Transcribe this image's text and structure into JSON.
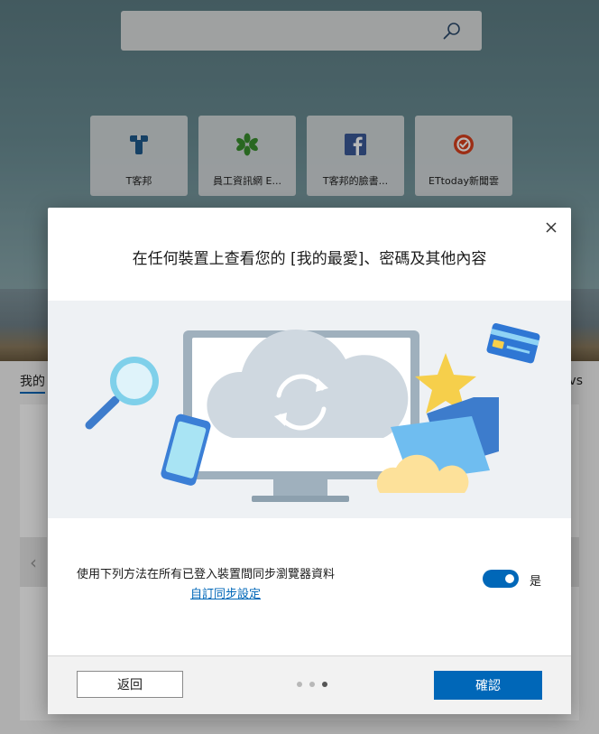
{
  "search": {
    "icon": "search-icon"
  },
  "quick_links": [
    {
      "label": "T客邦",
      "icon": "wrench-logo-icon",
      "color": "#1f5a8c"
    },
    {
      "label": "員工資訊網 E...",
      "icon": "green-asterisk-icon",
      "color": "#3a8f2e"
    },
    {
      "label": "T客邦的臉書...",
      "icon": "facebook-icon",
      "color": "#3b5998"
    },
    {
      "label": "ETtoday新聞雲",
      "icon": "ettoday-icon",
      "color": "#d9411e"
    }
  ],
  "feed": {
    "left_label": "我的",
    "right_label": "vs"
  },
  "dialog": {
    "title": "在任何裝置上查看您的 [我的最愛]、密碼及其他內容",
    "sync_text": "使用下列方法在所有已登入裝置間同步瀏覽器資料",
    "sync_link": "自訂同步設定",
    "toggle_label": "是",
    "toggle_on": true,
    "back_label": "返回",
    "ok_label": "確認",
    "page_count": 3,
    "current_page": 3
  },
  "colors": {
    "accent": "#0067b8",
    "dialog_bg": "#ffffff",
    "illustration_bg": "#eef1f4"
  }
}
